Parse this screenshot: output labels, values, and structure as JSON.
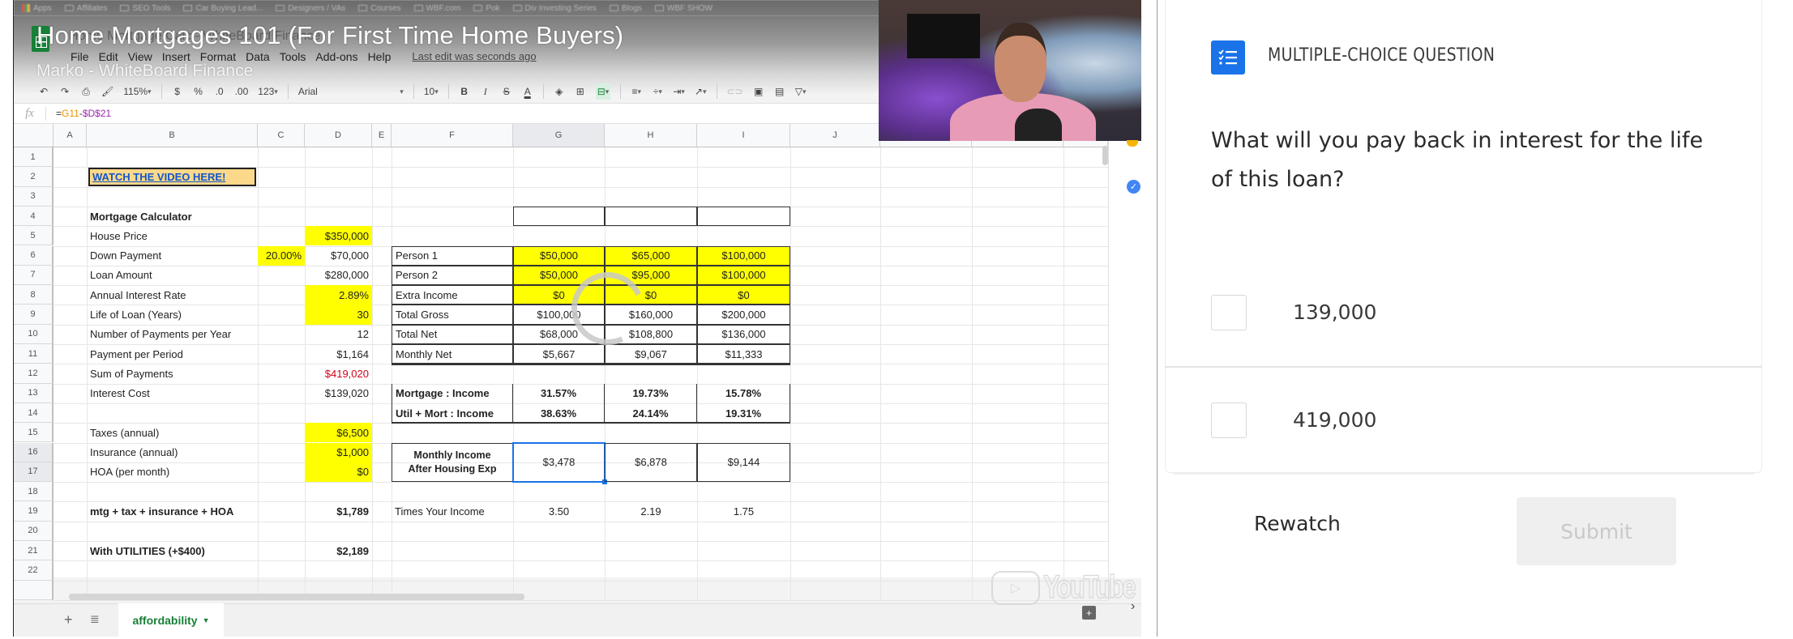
{
  "video": {
    "title": "Home Mortgages 101 (For First Time Home Buyers)",
    "channel": "Marko - WhiteBoard Finance",
    "bookmarks": [
      "Apps",
      "Affiliates",
      "SEO Tools",
      "Car Buying Lead...",
      "Designers / VAs",
      "Courses",
      "WBF.com",
      "Pok",
      "Div Investing Series",
      "Blogs",
      "WBF SHOW"
    ],
    "youtube_logo": "YouTube"
  },
  "sheet": {
    "doc_title": "Home Mortgage Calc - WhiteBoard Finance",
    "menu": [
      "File",
      "Edit",
      "View",
      "Insert",
      "Format",
      "Data",
      "Tools",
      "Add-ons",
      "Help"
    ],
    "last_edit": "Last edit was seconds ago",
    "toolbar": {
      "zoom": "115%",
      "currency": "$",
      "percent": "%",
      "dec_decrease": ".0",
      "dec_increase": ".00",
      "more_formats": "123",
      "font": "Arial",
      "font_size": "10",
      "bold": "B",
      "italic": "I",
      "strike": "S",
      "text_color": "A"
    },
    "formula": {
      "fx": "fx",
      "prefix": "=",
      "ref1": "G11",
      "op": "-",
      "ref2": "$D$21"
    },
    "columns": [
      "A",
      "B",
      "C",
      "D",
      "E",
      "F",
      "G",
      "H",
      "I",
      "J"
    ],
    "rows": [
      "1",
      "2",
      "3",
      "4",
      "5",
      "6",
      "7",
      "8",
      "9",
      "10",
      "11",
      "12",
      "13",
      "14",
      "15",
      "16",
      "17",
      "18",
      "19",
      "20",
      "21",
      "22"
    ],
    "watch_link": "WATCH THE VIDEO HERE!",
    "calc": {
      "title": "Mortgage Calculator",
      "house_price_label": "House Price",
      "house_price": "$350,000",
      "down_label": "Down Payment",
      "down_pct": "20.00%",
      "down_amt": "$70,000",
      "loan_label": "Loan Amount",
      "loan": "$280,000",
      "rate_label": "Annual Interest Rate",
      "rate": "2.89%",
      "life_label": "Life of Loan (Years)",
      "life": "30",
      "npy_label": "Number of Payments per Year",
      "npy": "12",
      "ppp_label": "Payment per Period",
      "ppp": "$1,164",
      "sum_label": "Sum of Payments",
      "sum": "$419,020",
      "interest_label": "Interest Cost",
      "interest": "$139,020",
      "taxes_label": "Taxes (annual)",
      "taxes": "$6,500",
      "ins_label": "Insurance (annual)",
      "ins": "$1,000",
      "hoa_label": "HOA (per month)",
      "hoa": "$0",
      "total_label": "mtg + tax + insurance + HOA",
      "total": "$1,789",
      "util_label": "With UTILITIES (+$400)",
      "util": "$2,189"
    },
    "income": {
      "labels": [
        "Person 1",
        "Person 2",
        "Extra Income",
        "Total Gross",
        "Total Net",
        "Monthly Net"
      ],
      "values": [
        [
          "$50,000",
          "$65,000",
          "$100,000"
        ],
        [
          "$50,000",
          "$95,000",
          "$100,000"
        ],
        [
          "$0",
          "$0",
          "$0"
        ],
        [
          "$100,000",
          "$160,000",
          "$200,000"
        ],
        [
          "$68,000",
          "$108,800",
          "$136,000"
        ],
        [
          "$5,667",
          "$9,067",
          "$11,333"
        ]
      ],
      "ratio_labels": [
        "Mortgage : Income",
        "Util + Mort : Income"
      ],
      "ratios": [
        [
          "31.57%",
          "19.73%",
          "15.78%"
        ],
        [
          "38.63%",
          "24.14%",
          "19.31%"
        ]
      ],
      "after_label_1": "Monthly Income",
      "after_label_2": "After Housing Exp",
      "after": [
        "$3,478",
        "$6,878",
        "$9,144"
      ],
      "times_label": "Times Your Income",
      "times": [
        "3.50",
        "2.19",
        "1.75"
      ]
    },
    "sheet_tab": "affordability"
  },
  "quiz": {
    "type_label": "MULTIPLE-CHOICE QUESTION",
    "question": "What will you pay back in interest for the life of this loan?",
    "options": [
      "139,000",
      "419,000"
    ],
    "rewatch": "Rewatch",
    "submit": "Submit",
    "accent": "#1a73e8"
  }
}
